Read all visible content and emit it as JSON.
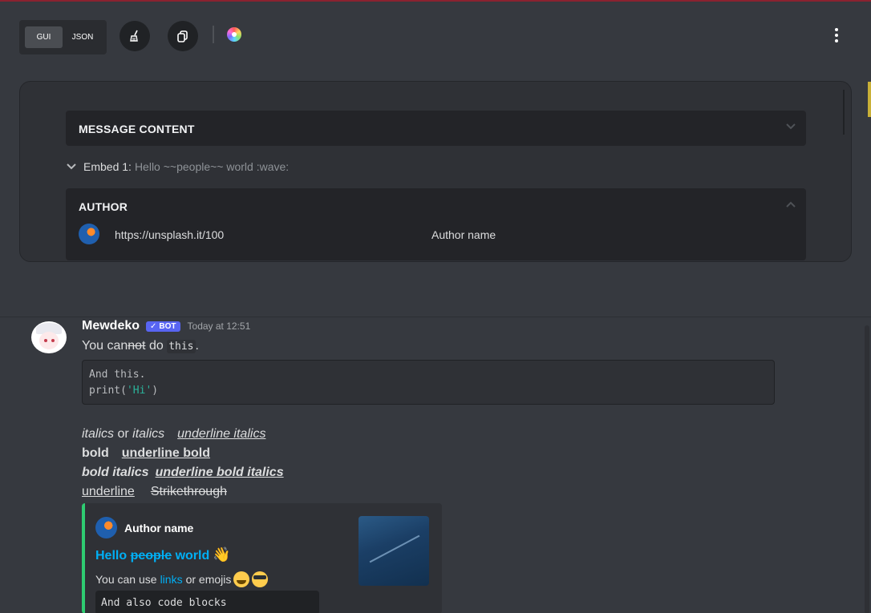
{
  "toolbar": {
    "mode_gui": "GUI",
    "mode_json": "JSON"
  },
  "editor": {
    "message_content_title": "MESSAGE CONTENT",
    "embed_label": "Embed 1:",
    "embed_summary": "Hello ~~people~~ world :wave:",
    "author_title": "AUTHOR",
    "author_icon_url": "https://unsplash.it/100",
    "author_name": "Author name"
  },
  "preview": {
    "bot_name": "Mewdeko",
    "bot_tag": "BOT",
    "timestamp": "Today at 12:51",
    "line1_a": "You can",
    "line1_strike": "not",
    "line1_b": " do ",
    "line1_code": "this",
    "line1_c": ".",
    "code_line1": "And this.",
    "code_line2_a": "print(",
    "code_line2_str": "'Hi'",
    "code_line2_b": ")",
    "italics1": "italics",
    "or": " or ",
    "italics2": "italics",
    "underline_italics": "underline italics",
    "bold": "bold",
    "underline_bold": "underline bold",
    "bold_italics": "bold italics",
    "underline_bold_italics": "underline bold italics",
    "underline": "underline",
    "strikethrough": "Strikethrough",
    "embed": {
      "accent_color": "#2ecc71",
      "author_name": "Author name",
      "title_a": "Hello ",
      "title_strike": "people",
      "title_b": " world",
      "desc_a": "You can use",
      "desc_link": "links",
      "desc_b": "or emojis",
      "code": "And also code blocks"
    }
  }
}
